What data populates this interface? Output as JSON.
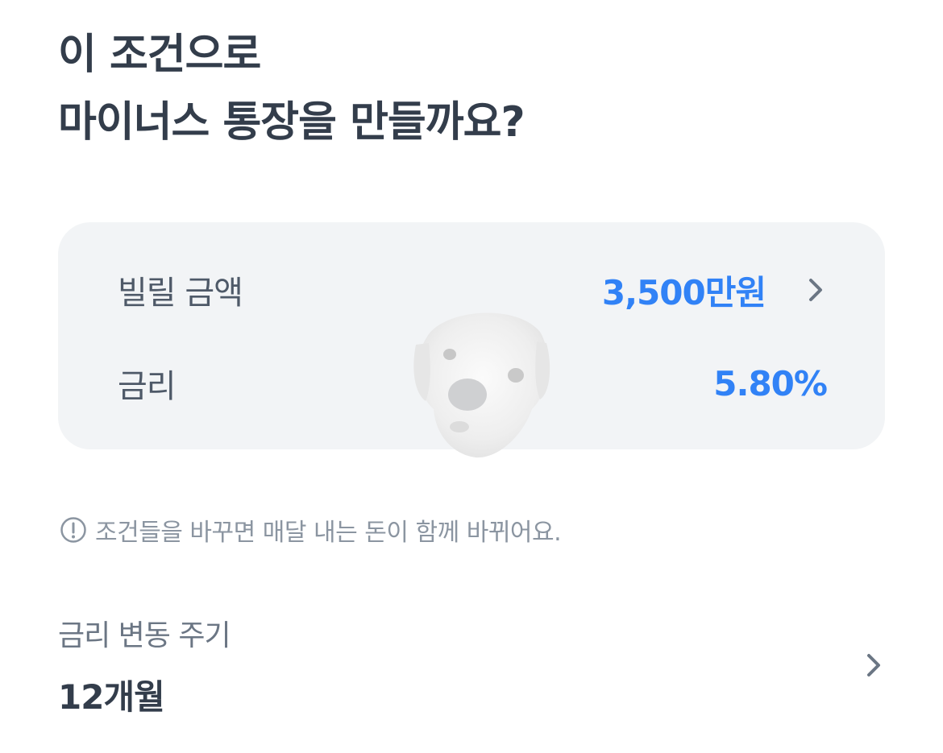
{
  "header": {
    "title_line1": "이 조건으로",
    "title_line2": "마이너스 통장을 만들까요?"
  },
  "conditions": {
    "loan_amount_label": "빌릴 금액",
    "loan_amount_value": "3,500만원",
    "interest_label": "금리",
    "interest_value": "5.80%"
  },
  "notice": {
    "icon": "info-circle-icon",
    "text": "조건들을 바꾸면 매달 내는 돈이 함께 바뀌어요."
  },
  "rate_period": {
    "label": "금리 변동 주기",
    "value": "12개월"
  },
  "colors": {
    "title": "#333d4b",
    "accent": "#3182f6",
    "card_bg": "#f2f4f6",
    "muted": "#8b95a1"
  }
}
